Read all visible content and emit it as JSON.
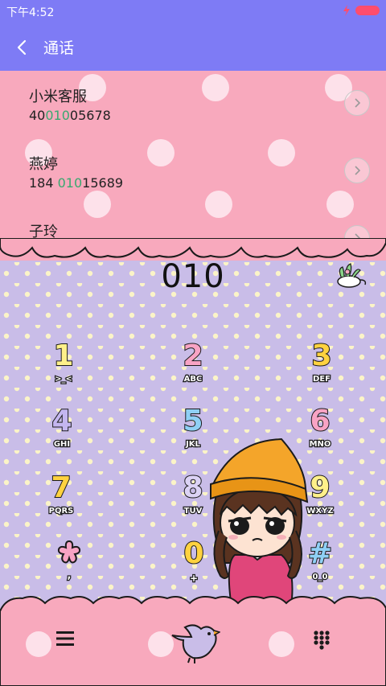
{
  "status": {
    "time": "下午4:52"
  },
  "header": {
    "title": "通话"
  },
  "contacts": [
    {
      "name": "小米客服",
      "number_pre": "40",
      "number_match": "010",
      "number_post": "05678"
    },
    {
      "name": "燕婷",
      "number_pre": "184 ",
      "number_match": "010",
      "number_post": "15689"
    },
    {
      "name": "子玲",
      "number_pre": "",
      "number_match": "",
      "number_post": ""
    }
  ],
  "dialer": {
    "input": "010",
    "keys": [
      {
        "num": "1",
        "sub": ">_<",
        "color": "#fff08a"
      },
      {
        "num": "2",
        "sub": "ABC",
        "color": "#f8a3c4"
      },
      {
        "num": "3",
        "sub": "DEF",
        "color": "#ffd23f"
      },
      {
        "num": "4",
        "sub": "GHI",
        "color": "#c4b6f0"
      },
      {
        "num": "5",
        "sub": "JKL",
        "color": "#8fd0f5"
      },
      {
        "num": "6",
        "sub": "MNO",
        "color": "#f8a3c4"
      },
      {
        "num": "7",
        "sub": "PQRS",
        "color": "#ffd23f"
      },
      {
        "num": "8",
        "sub": "TUV",
        "color": "#dcd3f5"
      },
      {
        "num": "9",
        "sub": "WXYZ",
        "color": "#fff08a"
      },
      {
        "num": "",
        "sub": ",",
        "color": "#f8a3c4",
        "icon": "flower-icon"
      },
      {
        "num": "0",
        "sub": "+",
        "color": "#ffd23f"
      },
      {
        "num": "#",
        "sub": "0_0",
        "color": "#8fd0f5"
      }
    ]
  },
  "colors": {
    "header": "#7e7bf5",
    "pink": "#f8a9bd",
    "lavender": "#c9bde8",
    "match": "#3aa870"
  },
  "icons": {
    "back": "back-arrow-icon",
    "chevron": "chevron-right-icon",
    "menu": "menu-icon",
    "call": "bird-call-icon",
    "keypad": "keypad-icon",
    "plant": "plant-icon"
  }
}
